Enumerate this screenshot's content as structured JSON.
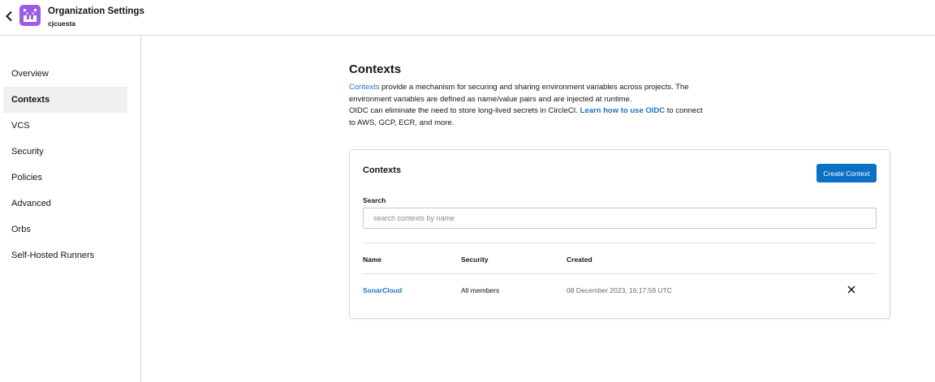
{
  "header": {
    "title": "Organization Settings",
    "org_name": "cjcuesta",
    "back_icon": "chevron-left-icon",
    "avatar_color": "#9b5de5"
  },
  "sidebar": {
    "items": [
      {
        "label": "Overview",
        "active": false
      },
      {
        "label": "Contexts",
        "active": true
      },
      {
        "label": "VCS",
        "active": false
      },
      {
        "label": "Security",
        "active": false
      },
      {
        "label": "Policies",
        "active": false
      },
      {
        "label": "Advanced",
        "active": false
      },
      {
        "label": "Orbs",
        "active": false
      },
      {
        "label": "Self-Hosted Runners",
        "active": false
      }
    ]
  },
  "main": {
    "title": "Contexts",
    "description": {
      "link1": "Contexts",
      "text1": " provide a mechanism for securing and sharing environment variables across projects. The environment variables are defined as name/value pairs and are injected at runtime.",
      "text2": "OIDC can eliminate the need to store long-lived secrets in CircleCI. ",
      "link2": "Learn how to use OIDC",
      "text3": " to connect to AWS, GCP, ECR, and more."
    }
  },
  "card": {
    "title": "Contexts",
    "create_button": "Create Context",
    "search_label": "Search",
    "search_placeholder": "search contexts by name",
    "search_value": "",
    "columns": [
      "Name",
      "Security",
      "Created"
    ],
    "rows": [
      {
        "name": "SonarCloud",
        "security": "All members",
        "created": "08 December 2023, 16:17:59 UTC",
        "delete_icon": "close-icon"
      }
    ]
  },
  "colors": {
    "accent": "#0a71c5",
    "link": "#1d73c9"
  }
}
